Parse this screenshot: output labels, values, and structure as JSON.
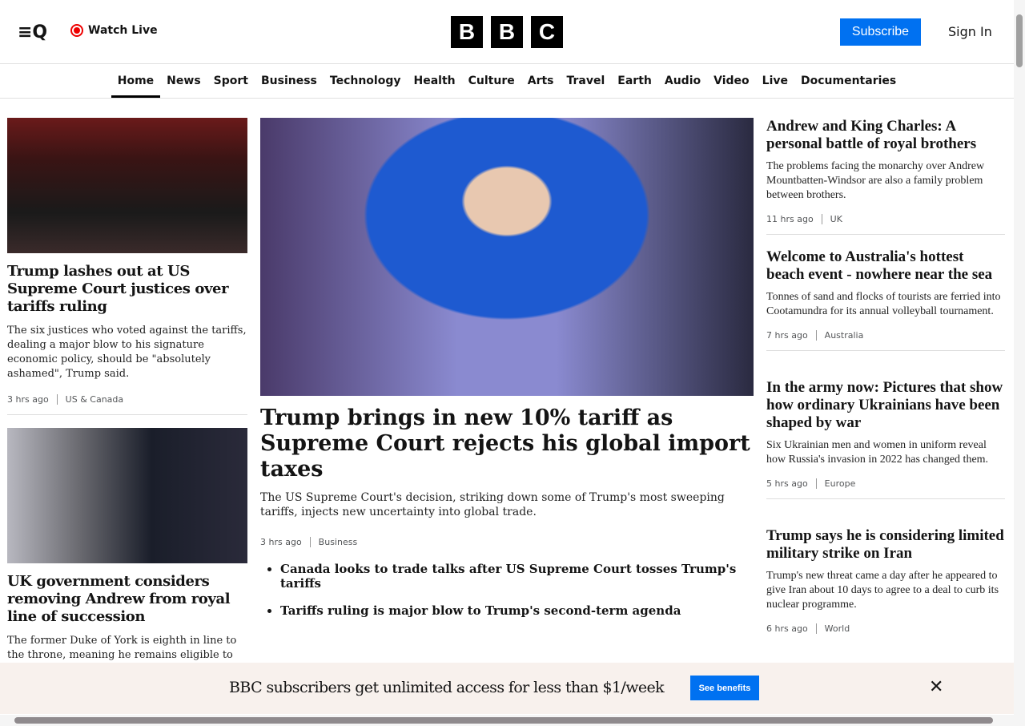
{
  "header": {
    "watch_live": "Watch Live",
    "logo": [
      "B",
      "B",
      "C"
    ],
    "subscribe": "Subscribe",
    "sign_in": "Sign In"
  },
  "nav": [
    "Home",
    "News",
    "Sport",
    "Business",
    "Technology",
    "Health",
    "Culture",
    "Arts",
    "Travel",
    "Earth",
    "Audio",
    "Video",
    "Live",
    "Documentaries"
  ],
  "left": [
    {
      "title": "Trump lashes out at US Supreme Court justices over tariffs ruling",
      "summary": "The six justices who voted against the tariffs, dealing a major blow to his signature economic policy, should be \"absolutely ashamed\", Trump said.",
      "time": "3 hrs ago",
      "section": "US & Canada"
    },
    {
      "title": "UK government considers removing Andrew from royal line of succession",
      "summary": "The former Duke of York is eighth in line to the throne, meaning he remains eligible to be King."
    }
  ],
  "main": {
    "title": "Trump brings in new 10% tariff as Supreme Court rejects his global import taxes",
    "summary": "The US Supreme Court's decision, striking down some of Trump's most sweeping tariffs, injects new uncertainty into global trade.",
    "time": "3 hrs ago",
    "section": "Business",
    "related": [
      "Canada looks to trade talks after US Supreme Court tosses Trump's tariffs",
      "Tariffs ruling is major blow to Trump's second-term agenda"
    ]
  },
  "right": [
    {
      "title": "Andrew and King Charles: A personal battle of royal brothers",
      "summary": "The problems facing the monarchy over Andrew Mountbatten-Windsor are also a family problem between brothers.",
      "time": "11 hrs ago",
      "section": "UK"
    },
    {
      "title": "Welcome to Australia's hottest beach event - nowhere near the sea",
      "summary": "Tonnes of sand and flocks of tourists are ferried into Cootamundra for its annual volleyball tournament.",
      "time": "7 hrs ago",
      "section": "Australia"
    },
    {
      "title": "In the army now: Pictures that show how ordinary Ukrainians have been shaped by war",
      "summary": "Six Ukrainian men and women in uniform reveal how Russia's invasion in 2022 has changed them.",
      "time": "5 hrs ago",
      "section": "Europe"
    },
    {
      "title": "Trump says he is considering limited military strike on Iran",
      "summary": "Trump's new threat came a day after he appeared to give Iran about 10 days to agree to a deal to curb its nuclear programme.",
      "time": "6 hrs ago",
      "section": "World"
    }
  ],
  "banner": {
    "text": "BBC subscribers get unlimited access for less than $1/week",
    "button": "See benefits"
  }
}
